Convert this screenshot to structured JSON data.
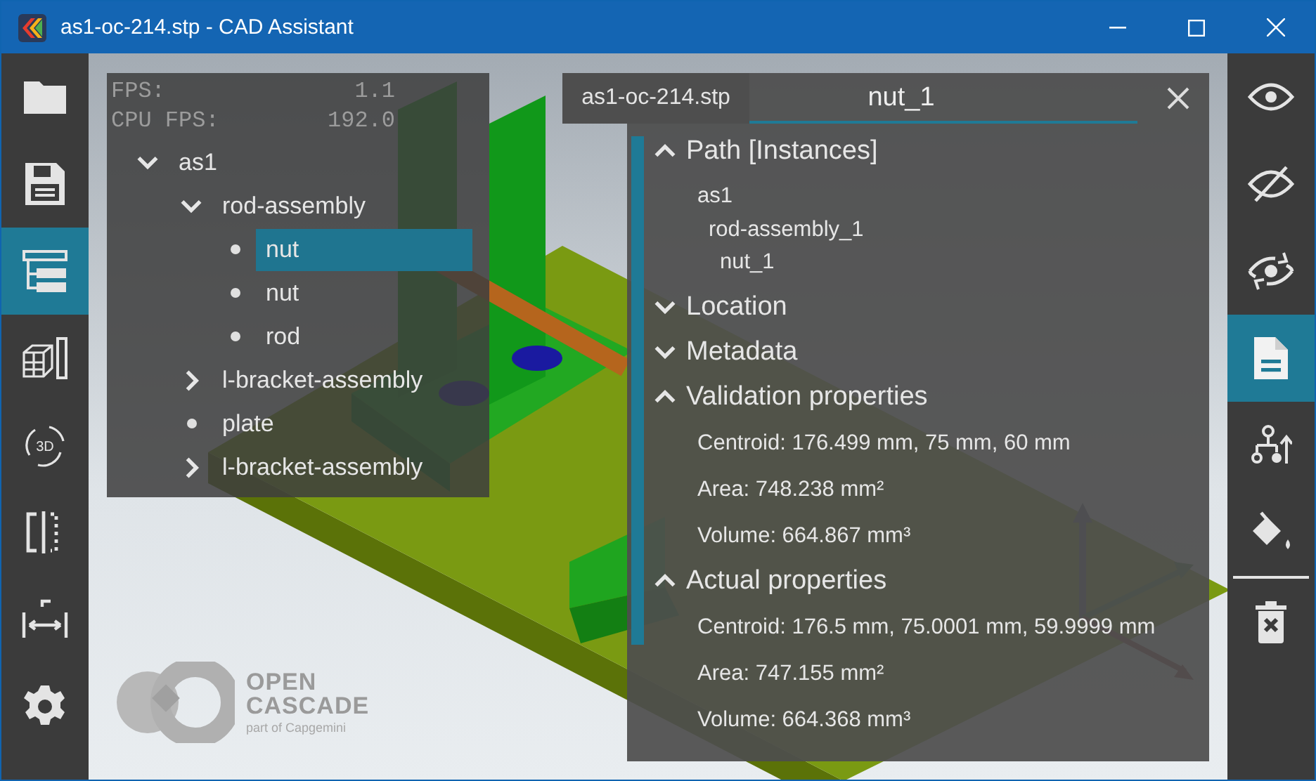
{
  "window": {
    "title": "as1-oc-214.stp - CAD Assistant"
  },
  "left_toolbar": [
    {
      "kind": "folder",
      "selected": false
    },
    {
      "kind": "save",
      "selected": false
    },
    {
      "kind": "tree",
      "selected": true
    },
    {
      "kind": "explode",
      "selected": false
    },
    {
      "kind": "rotate3d",
      "selected": false,
      "label": "3D"
    },
    {
      "kind": "section",
      "selected": false
    },
    {
      "kind": "measure",
      "selected": false
    },
    {
      "kind": "settings",
      "selected": false
    }
  ],
  "fps_overlay": [
    {
      "label": "FPS:",
      "value": "1.1"
    },
    {
      "label": "CPU FPS:",
      "value": "192.0"
    }
  ],
  "tree": [
    {
      "label": "as1",
      "kind": "assembly",
      "expanded": true,
      "selected": false,
      "children": [
        {
          "label": "rod-assembly",
          "kind": "assembly",
          "expanded": true,
          "selected": false,
          "children": [
            {
              "label": "nut",
              "kind": "part",
              "selected": true
            },
            {
              "label": "nut",
              "kind": "part",
              "selected": false
            },
            {
              "label": "rod",
              "kind": "part",
              "selected": false
            }
          ]
        },
        {
          "label": "l-bracket-assembly",
          "kind": "assembly",
          "expanded": false,
          "selected": false
        },
        {
          "label": "plate",
          "kind": "part",
          "selected": false
        },
        {
          "label": "l-bracket-assembly",
          "kind": "assembly",
          "expanded": false,
          "selected": false
        }
      ]
    }
  ],
  "document_tab": {
    "label": "as1-oc-214.stp"
  },
  "properties": {
    "title": "nut_1",
    "sections": [
      {
        "title": "Path [Instances]",
        "expanded": true,
        "path": [
          {
            "label": "as1",
            "children": [
              {
                "label": "rod-assembly_1",
                "children": [
                  {
                    "label": "nut_1"
                  }
                ]
              }
            ]
          }
        ]
      },
      {
        "title": "Location",
        "expanded": false
      },
      {
        "title": "Metadata",
        "expanded": false
      },
      {
        "title": "Validation properties",
        "expanded": true,
        "lines": [
          "Centroid: 176.499 mm, 75 mm, 60 mm",
          "Area: 748.238 mm²",
          "Volume: 664.867 mm³"
        ]
      },
      {
        "title": "Actual properties",
        "expanded": true,
        "lines": [
          "Centroid: 176.5 mm, 75.0001 mm, 59.9999 mm",
          "Area: 747.155 mm²",
          "Volume: 664.368 mm³"
        ]
      }
    ]
  },
  "logo": {
    "name_lines": [
      "OPEN",
      "CASCADE"
    ],
    "tagline": "part of Capgemini"
  },
  "right_toolbar": [
    {
      "kind": "show",
      "selected": false
    },
    {
      "kind": "hide",
      "selected": false
    },
    {
      "kind": "toggle",
      "selected": false
    },
    {
      "kind": "properties",
      "selected": true
    },
    {
      "kind": "hierarchy",
      "selected": false
    },
    {
      "kind": "paint",
      "selected": false
    },
    {
      "kind": "delete",
      "selected": false
    }
  ]
}
